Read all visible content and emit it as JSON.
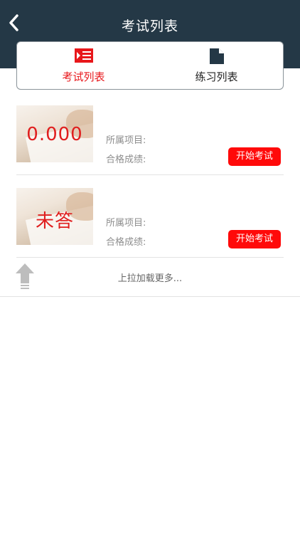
{
  "header": {
    "title": "考试列表",
    "back_icon": "chevron-left-icon"
  },
  "tabs": [
    {
      "label": "考试列表",
      "icon": "list-icon",
      "active": true,
      "color": "#e8171b"
    },
    {
      "label": "练习列表",
      "icon": "document-icon",
      "active": false,
      "color": "#243846"
    }
  ],
  "items": [
    {
      "score_overlay": "0.000",
      "project_label": "所属项目:",
      "project_value": "",
      "pass_label": "合格成绩:",
      "pass_value": "",
      "button_label": "开始考试"
    },
    {
      "score_overlay": "未答",
      "project_label": "所属项目:",
      "project_value": "",
      "pass_label": "合格成绩:",
      "pass_value": "",
      "button_label": "开始考试"
    }
  ],
  "load_more": {
    "text": "上拉加载更多...",
    "icon": "arrow-up-icon"
  },
  "colors": {
    "header_bg": "#243846",
    "accent_red": "#ff0a0a"
  }
}
